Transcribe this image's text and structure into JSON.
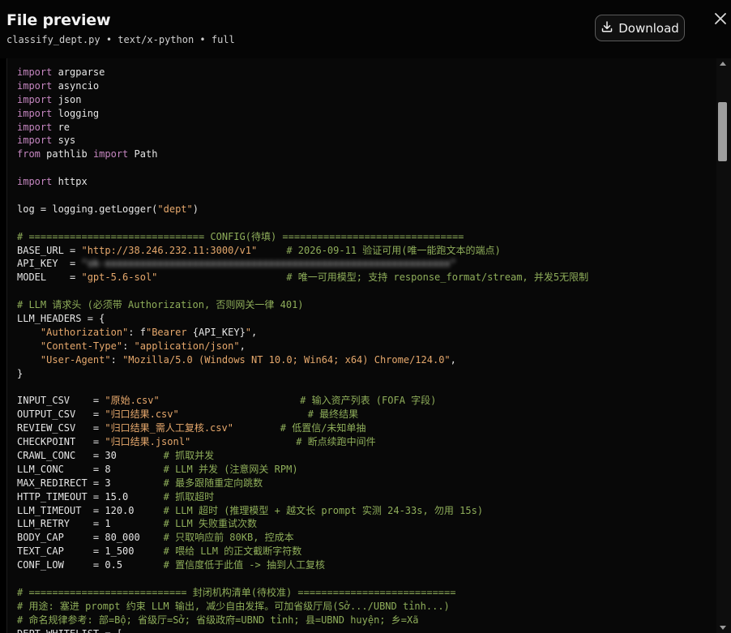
{
  "header": {
    "title": "File preview",
    "subtitle": "classify_dept.py • text/x-python • full",
    "download_label": "Download"
  },
  "code_lines": [
    [
      [
        "kw",
        "import"
      ],
      [
        "var",
        " argparse"
      ]
    ],
    [
      [
        "kw",
        "import"
      ],
      [
        "var",
        " asyncio"
      ]
    ],
    [
      [
        "kw",
        "import"
      ],
      [
        "var",
        " json"
      ]
    ],
    [
      [
        "kw",
        "import"
      ],
      [
        "var",
        " logging"
      ]
    ],
    [
      [
        "kw",
        "import"
      ],
      [
        "var",
        " re"
      ]
    ],
    [
      [
        "kw",
        "import"
      ],
      [
        "var",
        " sys"
      ]
    ],
    [
      [
        "kw",
        "from"
      ],
      [
        "var",
        " pathlib "
      ],
      [
        "kw",
        "import"
      ],
      [
        "var",
        " Path"
      ]
    ],
    [],
    [
      [
        "kw",
        "import"
      ],
      [
        "var",
        " httpx"
      ]
    ],
    [],
    [
      [
        "var",
        "log = logging.getLogger("
      ],
      [
        "str",
        "\"dept\""
      ],
      [
        "var",
        ")"
      ]
    ],
    [],
    [
      [
        "cm",
        "# ============================== CONFIG(待填) ==============================="
      ]
    ],
    [
      [
        "var",
        "BASE_URL = "
      ],
      [
        "str",
        "\"http://38.246.232.11:3000/v1\""
      ],
      [
        "var",
        "     "
      ],
      [
        "cm",
        "# 2026-09-11 验证可用(唯一能跑文本的端点)"
      ]
    ],
    [
      [
        "var",
        "API_KEY  = "
      ],
      [
        "blur",
        "\"sk-xxxxxxxxxxxxxxxxxxxxxxxxxxxxxxxxxxxxxxxxxxxxxxxxxxxxxxxxxxx\""
      ]
    ],
    [
      [
        "var",
        "MODEL    = "
      ],
      [
        "str",
        "\"gpt-5.6-sol\""
      ],
      [
        "var",
        "                      "
      ],
      [
        "cm",
        "# 唯一可用模型; 支持 response_format/stream, 并发5无限制"
      ]
    ],
    [],
    [
      [
        "cm",
        "# LLM 请求头 (必须带 Authorization, 否则网关一律 401)"
      ]
    ],
    [
      [
        "var",
        "LLM_HEADERS = {"
      ]
    ],
    [
      [
        "var",
        "    "
      ],
      [
        "str",
        "\"Authorization\""
      ],
      [
        "var",
        ": f"
      ],
      [
        "str",
        "\"Bearer "
      ],
      [
        "var",
        "{API_KEY}"
      ],
      [
        "str",
        "\""
      ],
      [
        "var",
        ","
      ]
    ],
    [
      [
        "var",
        "    "
      ],
      [
        "str",
        "\"Content-Type\""
      ],
      [
        "var",
        ": "
      ],
      [
        "str",
        "\"application/json\""
      ],
      [
        "var",
        ","
      ]
    ],
    [
      [
        "var",
        "    "
      ],
      [
        "str",
        "\"User-Agent\""
      ],
      [
        "var",
        ": "
      ],
      [
        "str",
        "\"Mozilla/5.0 (Windows NT 10.0; Win64; x64) Chrome/124.0\""
      ],
      [
        "var",
        ","
      ]
    ],
    [
      [
        "var",
        "}"
      ]
    ],
    [],
    [
      [
        "var",
        "INPUT_CSV    = "
      ],
      [
        "str",
        "\"原始.csv\""
      ],
      [
        "var",
        "                        "
      ],
      [
        "cm",
        "# 输入资产列表 (FOFA 字段)"
      ]
    ],
    [
      [
        "var",
        "OUTPUT_CSV   = "
      ],
      [
        "str",
        "\"归口结果.csv\""
      ],
      [
        "var",
        "                      "
      ],
      [
        "cm",
        "# 最终结果"
      ]
    ],
    [
      [
        "var",
        "REVIEW_CSV   = "
      ],
      [
        "str",
        "\"归口结果_需人工复核.csv\""
      ],
      [
        "var",
        "        "
      ],
      [
        "cm",
        "# 低置信/未知单抽"
      ]
    ],
    [
      [
        "var",
        "CHECKPOINT   = "
      ],
      [
        "str",
        "\"归口结果.jsonl\""
      ],
      [
        "var",
        "                  "
      ],
      [
        "cm",
        "# 断点续跑中间件"
      ]
    ],
    [
      [
        "var",
        "CRAWL_CONC   = 30        "
      ],
      [
        "cm",
        "# 抓取并发"
      ]
    ],
    [
      [
        "var",
        "LLM_CONC     = 8         "
      ],
      [
        "cm",
        "# LLM 并发 (注意网关 RPM)"
      ]
    ],
    [
      [
        "var",
        "MAX_REDIRECT = 3         "
      ],
      [
        "cm",
        "# 最多跟随重定向跳数"
      ]
    ],
    [
      [
        "var",
        "HTTP_TIMEOUT = 15.0      "
      ],
      [
        "cm",
        "# 抓取超时"
      ]
    ],
    [
      [
        "var",
        "LLM_TIMEOUT  = 120.0     "
      ],
      [
        "cm",
        "# LLM 超时 (推理模型 + 越文长 prompt 实测 24-33s, 勿用 15s)"
      ]
    ],
    [
      [
        "var",
        "LLM_RETRY    = 1         "
      ],
      [
        "cm",
        "# LLM 失败重试次数"
      ]
    ],
    [
      [
        "var",
        "BODY_CAP     = 80_000    "
      ],
      [
        "cm",
        "# 只取响应前 80KB, 控成本"
      ]
    ],
    [
      [
        "var",
        "TEXT_CAP     = 1_500     "
      ],
      [
        "cm",
        "# 喂给 LLM 的正文截断字符数"
      ]
    ],
    [
      [
        "var",
        "CONF_LOW     = 0.5       "
      ],
      [
        "cm",
        "# 置信度低于此值 -> 抽到人工复核"
      ]
    ],
    [],
    [
      [
        "cm",
        "# =========================== 封闭机构清单(待校准) ==========================="
      ]
    ],
    [
      [
        "cm",
        "# 用途: 塞进 prompt 约束 LLM 输出, 减少自由发挥。可加省级厅局(Sở.../UBND tỉnh...)"
      ]
    ],
    [
      [
        "cm",
        "# 命名规律参考: 部=Bộ; 省级厅=Sở; 省级政府=UBND tỉnh; 县=UBND huyện; 乡=Xã"
      ]
    ],
    [
      [
        "var",
        "DEPT_WHITELIST = ["
      ]
    ]
  ]
}
